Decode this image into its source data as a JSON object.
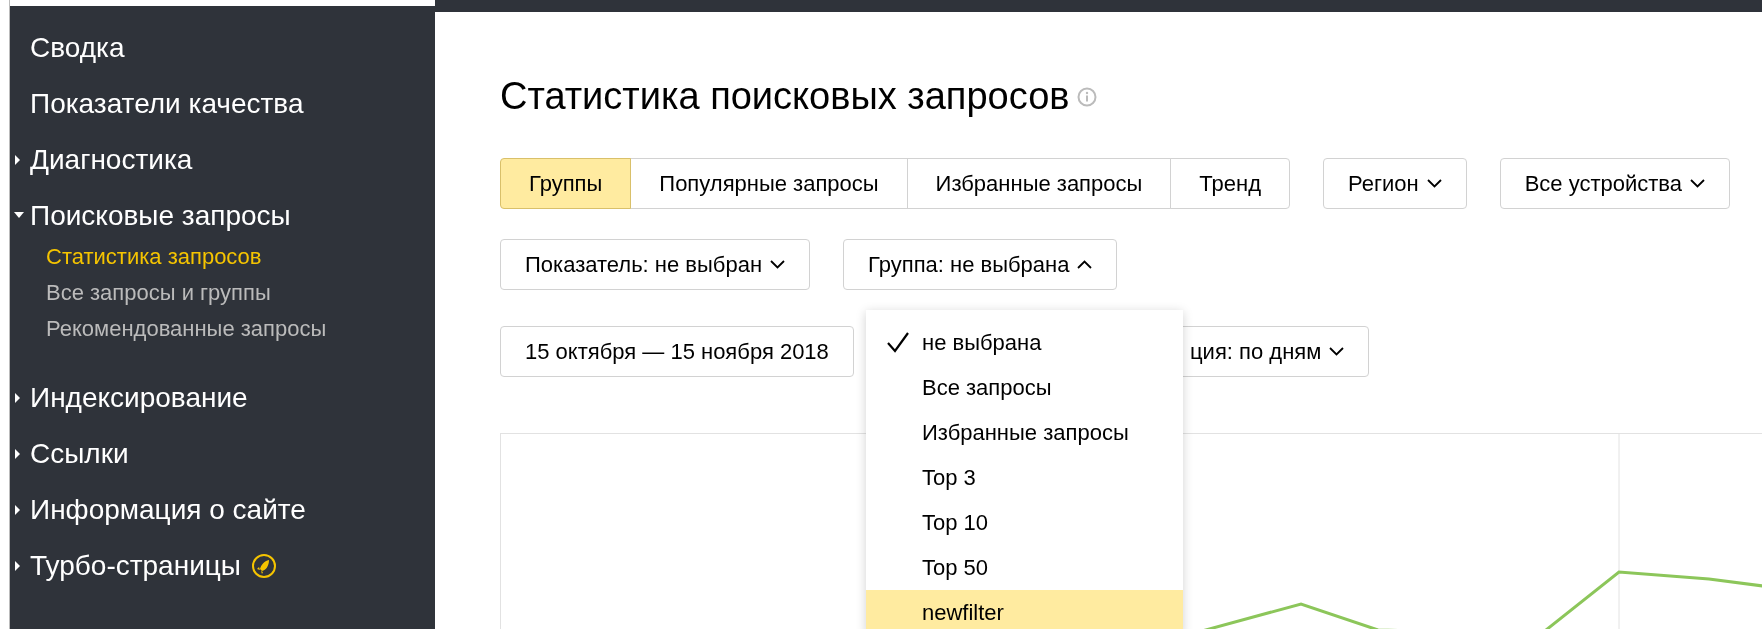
{
  "sidebar": {
    "items": [
      {
        "label": "Сводка",
        "kind": "link"
      },
      {
        "label": "Показатели качества",
        "kind": "link"
      },
      {
        "label": "Диагностика",
        "kind": "group",
        "expanded": false
      },
      {
        "label": "Поисковые запросы",
        "kind": "group",
        "expanded": true,
        "children": [
          {
            "label": "Статистика запросов",
            "selected": true
          },
          {
            "label": "Все запросы и группы",
            "selected": false
          },
          {
            "label": "Рекомендованные запросы",
            "selected": false
          }
        ]
      },
      {
        "label": "Индексирование",
        "kind": "group",
        "expanded": false
      },
      {
        "label": "Ссылки",
        "kind": "group",
        "expanded": false
      },
      {
        "label": "Информация о сайте",
        "kind": "group",
        "expanded": false
      },
      {
        "label": "Турбо-страницы",
        "kind": "group",
        "expanded": false,
        "badge": true
      }
    ]
  },
  "page": {
    "title": "Статистика поисковых запросов",
    "view_tabs": [
      {
        "label": "Группы",
        "selected": true
      },
      {
        "label": "Популярные запросы",
        "selected": false
      },
      {
        "label": "Избранные запросы",
        "selected": false
      },
      {
        "label": "Тренд",
        "selected": false
      }
    ],
    "filters": [
      {
        "label": "Регион"
      },
      {
        "label": "Все устройства"
      }
    ],
    "indicator_select": {
      "label": "Показатель: не выбран",
      "expanded": false
    },
    "group_select": {
      "label": "Группа: не выбрана",
      "expanded": true,
      "options": [
        {
          "label": "не выбрана",
          "selected": true,
          "highlighted": false
        },
        {
          "label": "Все запросы",
          "selected": false,
          "highlighted": false
        },
        {
          "label": "Избранные запросы",
          "selected": false,
          "highlighted": false
        },
        {
          "label": "Top 3",
          "selected": false,
          "highlighted": false
        },
        {
          "label": "Top 10",
          "selected": false,
          "highlighted": false
        },
        {
          "label": "Top 50",
          "selected": false,
          "highlighted": false
        },
        {
          "label": "newfilter",
          "selected": false,
          "highlighted": true
        }
      ]
    },
    "date_range": {
      "label": "15 октября — 15 ноября 2018"
    },
    "aggregation_select": {
      "label": "ция: по дням",
      "expanded": false
    }
  }
}
